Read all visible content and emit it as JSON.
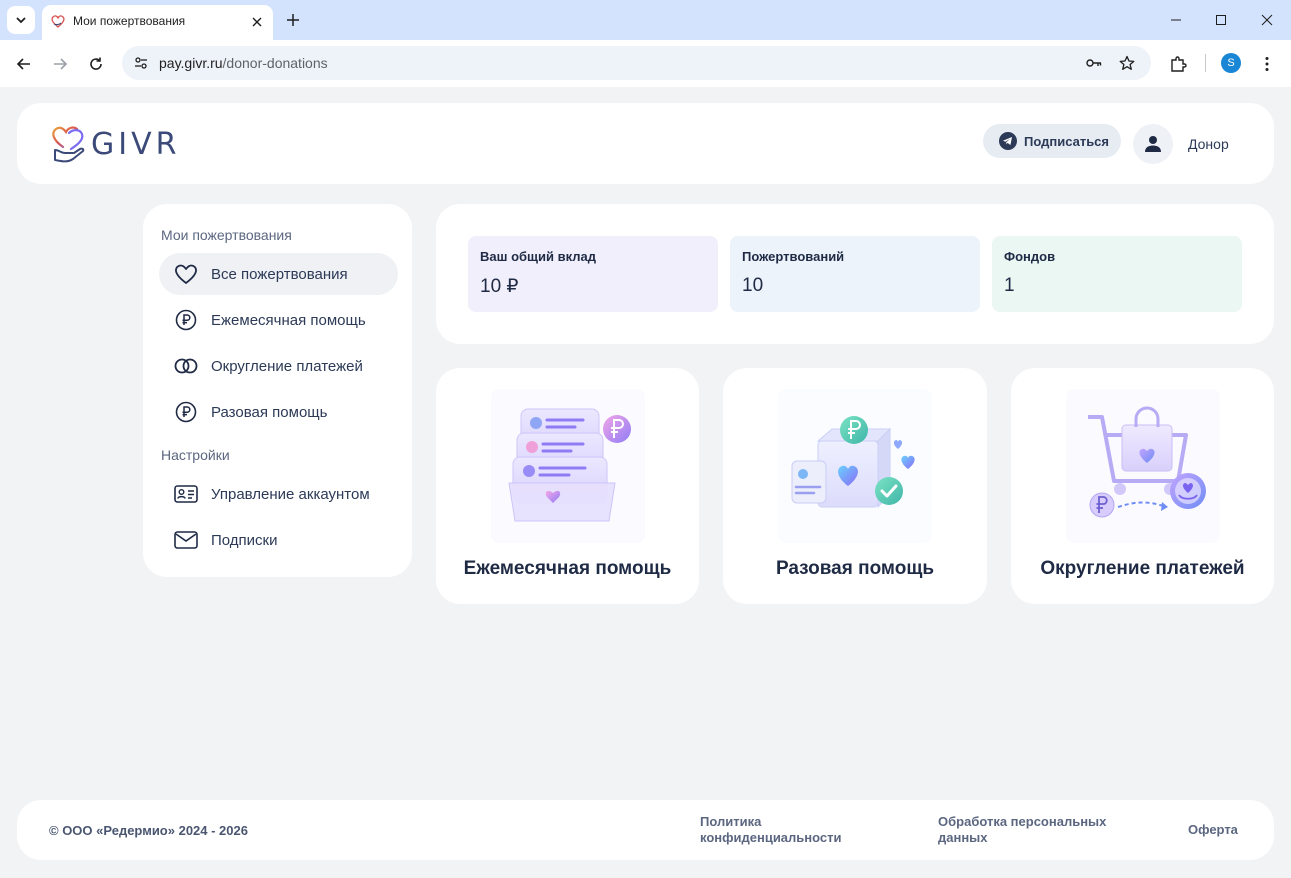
{
  "browser": {
    "tab_title": "Мои пожертвования",
    "url_domain": "pay.givr.ru",
    "url_path": "/donor-donations",
    "profile_initial": "S"
  },
  "header": {
    "logo_text": "GIVR",
    "subscribe_label": "Подписаться",
    "user_name": "Донор"
  },
  "sidebar": {
    "section_donations": "Мои пожертвования",
    "section_settings": "Настройки",
    "items": [
      {
        "label": "Все пожертвования",
        "icon": "heart-icon",
        "active": true
      },
      {
        "label": "Ежемесячная помощь",
        "icon": "ruble-circle-icon"
      },
      {
        "label": "Округление платежей",
        "icon": "rings-icon"
      },
      {
        "label": "Разовая помощь",
        "icon": "ruble-circle-icon"
      }
    ],
    "settings_items": [
      {
        "label": "Управление аккаунтом",
        "icon": "id-card-icon"
      },
      {
        "label": "Подписки",
        "icon": "mail-icon"
      }
    ]
  },
  "stats": [
    {
      "title": "Ваш общий вклад",
      "value": "10 ₽",
      "color": "#f1effb"
    },
    {
      "title": "Пожертвований",
      "value": "10",
      "color": "#ecf3fb"
    },
    {
      "title": "Фондов",
      "value": "1",
      "color": "#eaf7f3"
    }
  ],
  "products": [
    {
      "title": "Ежемесячная помощь",
      "illustration": "monthly-folders-illustration"
    },
    {
      "title": "Разовая помощь",
      "illustration": "donation-box-illustration"
    },
    {
      "title": "Округление платежей",
      "illustration": "shopping-cart-illustration"
    }
  ],
  "footer": {
    "copyright": "© ООО «Редермио» 2024 - 2026",
    "privacy_line1": "Политика",
    "privacy_line2": "конфиденциальности",
    "personal_line1": "Обработка персональных",
    "personal_line2": "данных",
    "offer": "Оферта"
  },
  "colors": {
    "page_bg": "#f2f3f5",
    "accent_purple": "#7c6cf0",
    "text_dark": "#1f2a44"
  }
}
